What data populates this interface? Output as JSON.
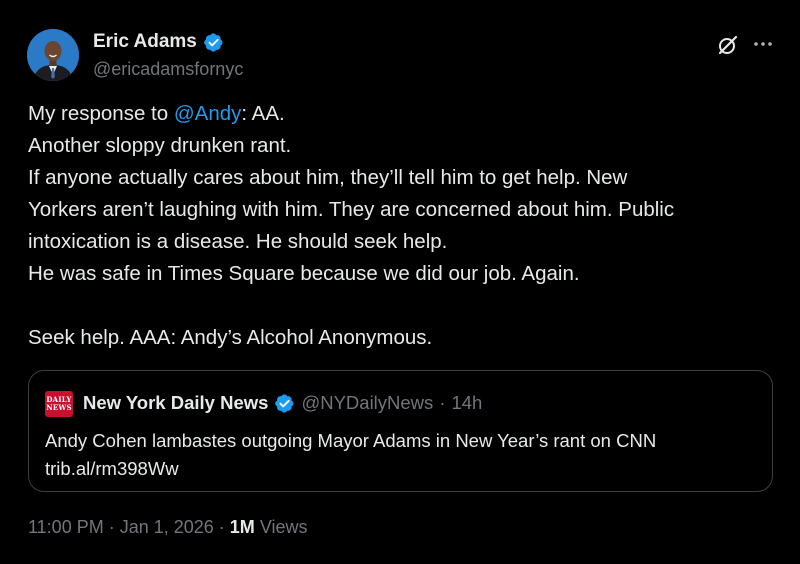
{
  "author": {
    "name": "Eric Adams",
    "handle": "@ericadamsfornyc",
    "verified": true
  },
  "colors": {
    "background": "#000000",
    "text": "#e7e9ea",
    "muted": "#71767b",
    "accent": "#1d9bf0",
    "border": "#3a3f44",
    "logo_red": "#c8102e"
  },
  "icons": {
    "grok": "grok-icon",
    "more": "more-icon",
    "verified": "verified-badge-icon"
  },
  "tweet": {
    "line1_prefix": "My response to ",
    "mention": "@Andy",
    "line1_suffix": ": AA.",
    "line2": "Another sloppy drunken rant.",
    "line3": "If anyone actually cares about him, they’ll tell him to get help. New",
    "line4": "Yorkers aren’t laughing with him. They are concerned about him. Public",
    "line5": "intoxication is a disease. He should seek help.",
    "line6": "He was safe in Times Square because we did our job. Again.",
    "line7": "Seek help. AAA: Andy’s Alcohol Anonymous."
  },
  "quote": {
    "logo_line1": "DAILY",
    "logo_line2": "NEWS",
    "name": "New York Daily News",
    "verified": true,
    "handle": "@NYDailyNews",
    "separator": "·",
    "time": "14h",
    "text_line1": "Andy Cohen lambastes outgoing Mayor Adams in New Year’s rant on CNN",
    "text_line2": "trib.al/rm398Ww"
  },
  "footer": {
    "time": "11:00 PM",
    "dot1": " · ",
    "date": "Jan 1, 2026",
    "dot2": " · ",
    "views_count": "1M",
    "views_label": " Views"
  }
}
